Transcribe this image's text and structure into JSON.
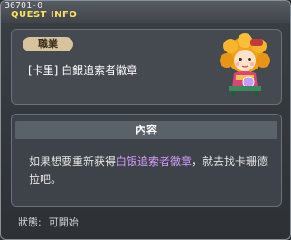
{
  "header": {
    "quest_id": "36701-0",
    "title": "QUEST INFO"
  },
  "quest": {
    "job_badge": "職業",
    "title": "[卡里] 白銀追索者徽章",
    "avatar_icon": "npc-girl-avatar-icon"
  },
  "content": {
    "header": "內容",
    "text_before": "如果想要重新获得",
    "text_highlight": "白银追索者徽章",
    "text_after": "，就去找卡珊德拉吧。",
    "highlight_color": "#d89bff"
  },
  "status": {
    "label": "狀態:",
    "value": "可開始"
  }
}
